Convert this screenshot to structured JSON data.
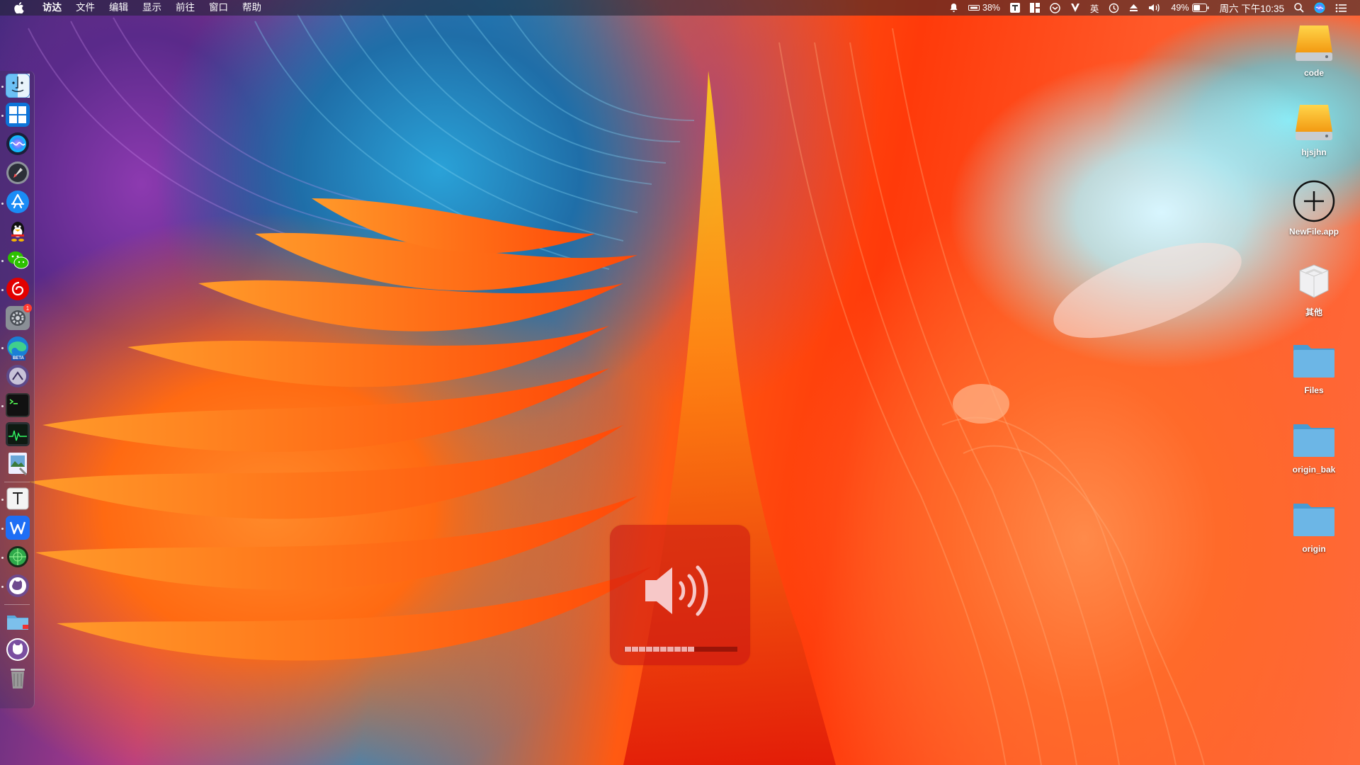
{
  "menubar": {
    "apple_icon": "apple-logo-icon",
    "app_name": "访达",
    "menus": [
      "文件",
      "编辑",
      "显示",
      "前往",
      "窗口",
      "帮助"
    ],
    "status": {
      "notification_icon": "bell-icon",
      "memory_percent": "38%",
      "t_icon": "t-app-icon",
      "layout_icon": "window-layout-icon",
      "sync_icon": "sync-icon",
      "v_icon": "v-app-icon",
      "input_method": "英",
      "time_machine_icon": "clock-history-icon",
      "eject_icon": "eject-icon",
      "volume_icon": "speaker-icon",
      "battery_percent": "49%",
      "datetime": "周六 下午10:35",
      "spotlight_icon": "search-icon",
      "siri_icon": "siri-icon",
      "control_icon": "list-icon"
    }
  },
  "dock": {
    "items": [
      {
        "name": "finder-icon",
        "running": true
      },
      {
        "name": "windows-app-icon",
        "running": true
      },
      {
        "name": "siri-app-icon",
        "running": false
      },
      {
        "name": "launchpad-icon",
        "running": false
      },
      {
        "name": "app-store-icon",
        "running": false
      },
      {
        "name": "qq-icon",
        "running": true
      },
      {
        "name": "wechat-icon",
        "running": true
      },
      {
        "name": "netease-music-icon",
        "running": true
      },
      {
        "name": "system-preferences-icon",
        "running": false,
        "badge": "1"
      },
      {
        "name": "edge-beta-icon",
        "running": true,
        "tag": "BETA"
      },
      {
        "name": "alfred-icon",
        "running": false
      },
      {
        "name": "terminal-icon",
        "running": true
      },
      {
        "name": "activity-monitor-icon",
        "running": false
      },
      {
        "name": "preview-icon",
        "running": false
      },
      {
        "name": "typora-icon",
        "running": true
      },
      {
        "name": "wps-icon",
        "running": true
      },
      {
        "name": "network-icon",
        "running": true
      },
      {
        "name": "github-desktop-icon",
        "running": true
      },
      {
        "name": "downloads-folder-icon",
        "running": false
      },
      {
        "name": "github-icon",
        "running": false
      },
      {
        "name": "trash-icon",
        "running": false
      }
    ]
  },
  "desktop": {
    "icons": [
      {
        "label": "code",
        "kind": "drive"
      },
      {
        "label": "hjsjhn",
        "kind": "drive"
      },
      {
        "label": "NewFile.app",
        "kind": "app"
      },
      {
        "label": "其他",
        "kind": "disk"
      },
      {
        "label": "Files",
        "kind": "folder"
      },
      {
        "label": "origin_bak",
        "kind": "folder"
      },
      {
        "label": "origin",
        "kind": "folder"
      }
    ]
  },
  "volume_hud": {
    "icon": "speaker-volume-icon",
    "level_segments_on": 10,
    "level_segments_total": 16
  },
  "colors": {
    "hud_background": "#c81414",
    "folder_blue": "#5aa9dc",
    "drive_orange": "#f5a623"
  }
}
